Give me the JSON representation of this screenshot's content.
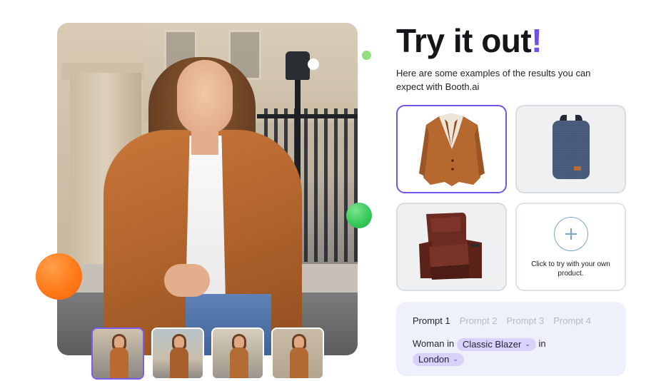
{
  "header": {
    "title_main": "Try it out",
    "title_bang": "!",
    "subtitle": "Here are some examples of the results you can expect with Booth.ai"
  },
  "products": [
    {
      "name": "brown-blazer",
      "icon": "blazer-image",
      "selected": true
    },
    {
      "name": "navy-backpack",
      "icon": "backpack-image",
      "selected": false
    },
    {
      "name": "leather-recliner",
      "icon": "recliner-image",
      "selected": false
    }
  ],
  "upload": {
    "icon": "plus-icon",
    "text": "Click to try with your own product."
  },
  "prompt": {
    "tabs": [
      "Prompt 1",
      "Prompt 2",
      "Prompt 3",
      "Prompt 4"
    ],
    "active_tab": 0,
    "prefix": "Woman in",
    "product_chip": "Classic Blazer",
    "joiner": "in",
    "location_chip": "London"
  },
  "thumbnails": [
    {
      "name": "thumb-1",
      "active": true
    },
    {
      "name": "thumb-2",
      "active": false
    },
    {
      "name": "thumb-3",
      "active": false
    },
    {
      "name": "thumb-4",
      "active": false
    }
  ],
  "colors": {
    "accent": "#6f4ff2",
    "selected_border": "#7254e8",
    "chip_bg": "#d9d3fb",
    "prompt_panel_bg": "#eef0fb",
    "orange_dot": "#ff7a1a",
    "green_dot": "#34c759"
  }
}
